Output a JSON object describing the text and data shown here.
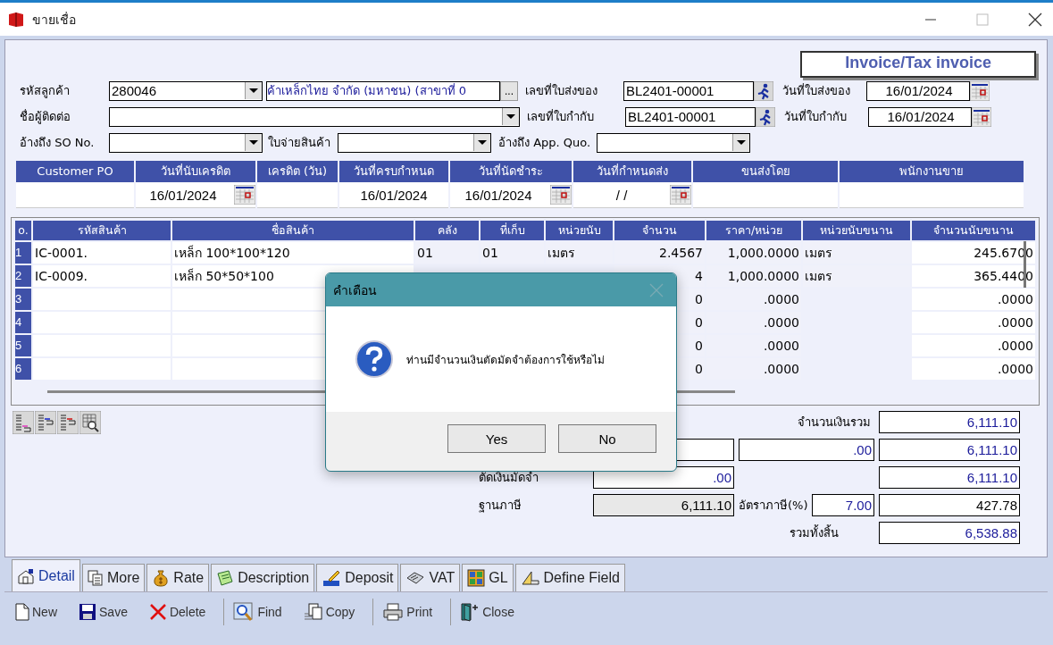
{
  "window": {
    "title": "ขายเชื่อ"
  },
  "document_type": "Invoice/Tax invoice",
  "header_rows": [
    {
      "fields": [
        {
          "kind": "combo",
          "label": "รหัสลูกค้า",
          "value": "280046"
        },
        {
          "kind": "lookup",
          "value": "ค้าเหล็กไทย จำกัด (มหาชน) (สาขาที่ 0",
          "button": "..."
        },
        {
          "kind": "runner",
          "label": "เลขที่ใบส่งของ",
          "value": "BL2401-00001"
        },
        {
          "kind": "date",
          "label": "วันที่ใบส่งของ",
          "value": "16/01/2024"
        }
      ]
    },
    {
      "fields": [
        {
          "kind": "combo",
          "label": "ชื่อผู้ติดต่อ"
        },
        {
          "kind": "runner",
          "label": "เลขที่ใบกำกับ",
          "value": "BL2401-00001"
        },
        {
          "kind": "date",
          "label": "วันที่ใบกำกับ",
          "value": "16/01/2024"
        }
      ]
    },
    {
      "fields": [
        {
          "kind": "combo",
          "label": "อ้างถึง SO No."
        },
        {
          "kind": "combo",
          "label": "ใบจ่ายสินค้า"
        },
        {
          "kind": "combo",
          "label": "อ้างถึง App. Quo."
        }
      ]
    }
  ],
  "info_grid": [
    {
      "heading": "Customer PO",
      "calendar": false
    },
    {
      "heading": "วันที่นับเครดิต",
      "value": "16/01/2024",
      "calendar": true
    },
    {
      "heading": "เครดิต (วัน)",
      "calendar": false
    },
    {
      "heading": "วันที่ครบกำหนด",
      "value": "16/01/2024",
      "calendar": false
    },
    {
      "heading": "วันที่นัดชำระ",
      "value": "16/01/2024",
      "calendar": true
    },
    {
      "heading": "วันที่กำหนดส่ง",
      "value": " / /",
      "calendar": true
    },
    {
      "heading": "ขนส่งโดย",
      "calendar": false
    },
    {
      "heading": "พนักงานขาย",
      "calendar": false
    }
  ],
  "items": {
    "columns": [
      "o.",
      "รหัสสินค้า",
      "ชื่อสินค้า",
      "คลัง",
      "ที่เก็บ",
      "หน่วยนับ",
      "จำนวน",
      "ราคา/หน่วย",
      "หน่วยนับขนาน",
      "จำนวนนับขนาน"
    ],
    "rows": [
      [
        "1",
        "IC-0001.",
        "เหล็ก 100*100*120",
        "01",
        "01",
        "เมตร",
        "2.4567",
        "1,000.0000",
        "เมตร",
        "245.6700"
      ],
      [
        "2",
        "IC-0009.",
        "เหล็ก 50*50*100",
        "",
        "",
        "",
        "4",
        "1,000.0000",
        "เมตร",
        "365.4400"
      ],
      [
        "3",
        "",
        "",
        "",
        "",
        "",
        "0",
        ".0000",
        "",
        ".0000"
      ],
      [
        "4",
        "",
        "",
        "",
        "",
        "",
        "0",
        ".0000",
        "",
        ".0000"
      ],
      [
        "5",
        "",
        "",
        "",
        "",
        "",
        "0",
        ".0000",
        "",
        ".0000"
      ],
      [
        "6",
        "",
        "",
        "",
        "",
        "",
        "0",
        ".0000",
        "",
        ".0000"
      ]
    ]
  },
  "totals": {
    "gross_label": "จำนวนเงินรวม",
    "gross": "6,111.10",
    "discount_mid": ".00",
    "after_discount": "6,111.10",
    "deposit_label": "ตัดเงินมัดจำ",
    "deposit": ".00",
    "after_deposit": "6,111.10",
    "tax_base_label": "ฐานภาษี",
    "tax_base": "6,111.10",
    "tax_rate_label": "อัตราภาษี(%)",
    "tax_rate": "7.00",
    "tax": "427.78",
    "total_label": "รวมทั้งสิ้น",
    "total": "6,538.88"
  },
  "tabs": [
    {
      "label": "Detail",
      "selected": true
    },
    {
      "label": "More",
      "selected": false
    },
    {
      "label": "Rate",
      "selected": false
    },
    {
      "label": "Description",
      "selected": false
    },
    {
      "label": "Deposit",
      "selected": false
    },
    {
      "label": "VAT",
      "selected": false
    },
    {
      "label": "GL",
      "selected": false
    },
    {
      "label": "Define Field",
      "selected": false
    }
  ],
  "toolbar": [
    "New",
    "Save",
    "Delete",
    "Find",
    "Copy",
    "Print",
    "Close"
  ],
  "dialog": {
    "title": "คำเตือน",
    "message": "ท่านมีจำนวนเงินตัดมัดจำต้องการใช้หรือไม่",
    "buttons": [
      "Yes",
      "No"
    ]
  }
}
